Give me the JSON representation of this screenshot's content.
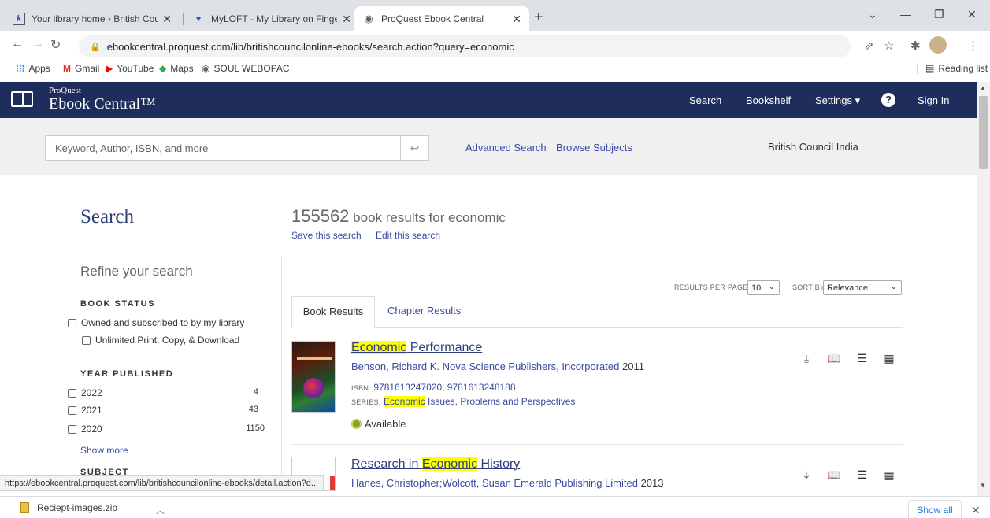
{
  "browser": {
    "tabs": [
      {
        "title": "Your library home › British Counc",
        "favicon": "k"
      },
      {
        "title": "MyLOFT - My Library on Finger T",
        "favicon": "♥"
      },
      {
        "title": "ProQuest Ebook Central",
        "favicon": "◉"
      }
    ],
    "url": "ebookcentral.proquest.com/lib/britishcouncilonline-ebooks/search.action?query=economic",
    "bookmarks": [
      {
        "label": "Apps",
        "icon": "apps-grid-icon"
      },
      {
        "label": "Gmail",
        "icon": "gmail-icon"
      },
      {
        "label": "YouTube",
        "icon": "youtube-icon"
      },
      {
        "label": "Maps",
        "icon": "maps-icon"
      },
      {
        "label": "SOUL WEBOPAC",
        "icon": "globe-icon"
      }
    ],
    "reading_list": "Reading list",
    "status_url": "https://ebookcentral.proquest.com/lib/britishcouncilonline-ebooks/detail.action?d...",
    "download_file": "Reciept-images.zip",
    "show_all": "Show all"
  },
  "header": {
    "brand_small": "ProQuest",
    "brand": "Ebook Central™",
    "nav": {
      "search": "Search",
      "bookshelf": "Bookshelf",
      "settings": "Settings ▾",
      "sign_in": "Sign In"
    },
    "color": "#1f2d5c"
  },
  "search_strip": {
    "placeholder": "Keyword, Author, ISBN, and more",
    "advanced": "Advanced Search",
    "browse": "Browse Subjects",
    "institution": "British Council India"
  },
  "sidebar": {
    "title": "Search",
    "refine": "Refine your search",
    "book_status_heading": "BOOK STATUS",
    "book_status": [
      "Owned and subscribed to by my library",
      "Unlimited Print, Copy, & Download"
    ],
    "year_heading": "YEAR PUBLISHED",
    "years": [
      {
        "year": "2022",
        "count": "4"
      },
      {
        "year": "2021",
        "count": "43"
      },
      {
        "year": "2020",
        "count": "1150"
      }
    ],
    "show_more": "Show more",
    "subject_heading": "SUBJECT"
  },
  "results": {
    "count": "155562",
    "count_suffix": "book results for economic",
    "save": "Save this search",
    "edit": "Edit this search",
    "rpp_label": "RESULTS PER PAGE",
    "rpp_value": "10",
    "sort_label": "SORT BY",
    "sort_value": "Relevance",
    "tab_book": "Book Results",
    "tab_chapter": "Chapter Results",
    "items": [
      {
        "title_hl": "Economic",
        "title_rest": " Performance",
        "authors": "Benson, Richard K.  Nova Science Publishers, Incorporated",
        "year": "2011",
        "isbn_label": "ISBN:",
        "isbn": "9781613247020, 9781613248188",
        "series_label": "SERIES:",
        "series_hl": "Economic",
        "series_rest": " Issues, Problems and Perspectives",
        "availability": "Available"
      },
      {
        "title_pre": "Research in ",
        "title_hl": "Economic",
        "title_rest": " History",
        "authors": "Hanes, Christopher;Wolcott, Susan  Emerald Publishing Limited",
        "year": "2013"
      }
    ]
  }
}
